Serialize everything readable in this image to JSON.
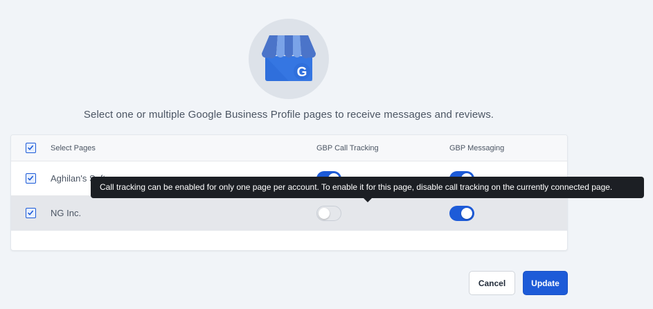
{
  "logo": {
    "icon": "google-business-profile-icon",
    "letter": "G"
  },
  "subtitle": "Select one or multiple Google Business Profile pages to receive messages and reviews.",
  "table": {
    "columns": {
      "select": "Select Pages",
      "call_tracking": "GBP Call Tracking",
      "messaging": "GBP Messaging"
    },
    "rows": [
      {
        "name": "Aghilan's Software",
        "selected": true,
        "call_tracking": true,
        "messaging": true
      },
      {
        "name": "NG Inc.",
        "selected": true,
        "call_tracking": false,
        "messaging": true
      }
    ]
  },
  "tooltip": "Call tracking can be enabled for only one page per account. To enable it for this page, disable call tracking on the currently connected page.",
  "buttons": {
    "cancel": "Cancel",
    "update": "Update"
  },
  "colors": {
    "primary": "#1d5bd8",
    "tooltip_bg": "#1c1f24",
    "page_bg": "#f1f4f8"
  }
}
